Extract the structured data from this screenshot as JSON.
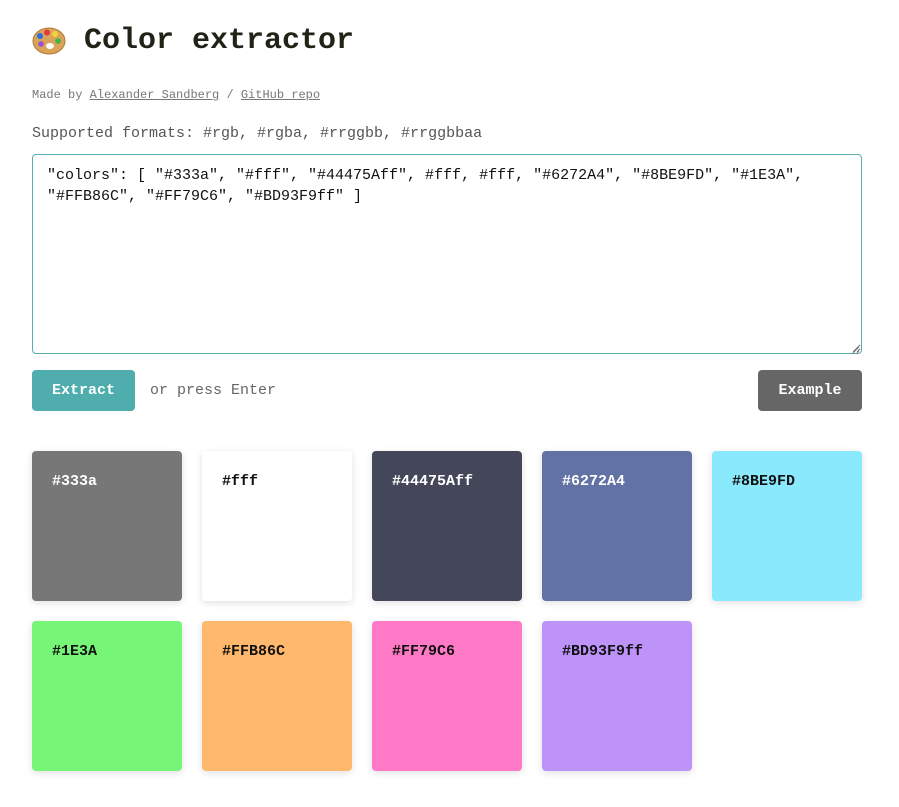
{
  "header": {
    "icon": "artist-palette-icon",
    "title": "Color extractor"
  },
  "credits": {
    "prefix": "Made by",
    "author_link": "Alexander Sandberg",
    "separator": "/",
    "repo_link": "GitHub repo"
  },
  "formats_text": "Supported formats: #rgb, #rgba, #rrggbb, #rrggbbaa",
  "input": {
    "value": "\"colors\": [ \"#333a\", \"#fff\", \"#44475Aff\", #fff, #fff, \"#6272A4\", \"#8BE9FD\", \"#1E3A\", \"#FFB86C\", \"#FF79C6\", \"#BD93F9ff\" ]"
  },
  "controls": {
    "extract_label": "Extract",
    "hint": "or press Enter",
    "example_label": "Example"
  },
  "swatches": [
    {
      "label": "#333a",
      "bg": "#777777",
      "fg": "#ffffff"
    },
    {
      "label": "#fff",
      "bg": "#ffffff",
      "fg": "#111111"
    },
    {
      "label": "#44475Aff",
      "bg": "#44475a",
      "fg": "#ffffff"
    },
    {
      "label": "#6272A4",
      "bg": "#6272a4",
      "fg": "#ffffff"
    },
    {
      "label": "#8BE9FD",
      "bg": "#8be9fd",
      "fg": "#111111"
    },
    {
      "label": "#1E3A",
      "bg": "#77f577",
      "fg": "#111111"
    },
    {
      "label": "#FFB86C",
      "bg": "#ffb86c",
      "fg": "#111111"
    },
    {
      "label": "#FF79C6",
      "bg": "#ff79c6",
      "fg": "#111111"
    },
    {
      "label": "#BD93F9ff",
      "bg": "#bd93f9",
      "fg": "#111111"
    }
  ],
  "colors": {
    "accent": "#4fadad",
    "example_button": "#666666",
    "textarea_border": "#5aaeb0"
  }
}
